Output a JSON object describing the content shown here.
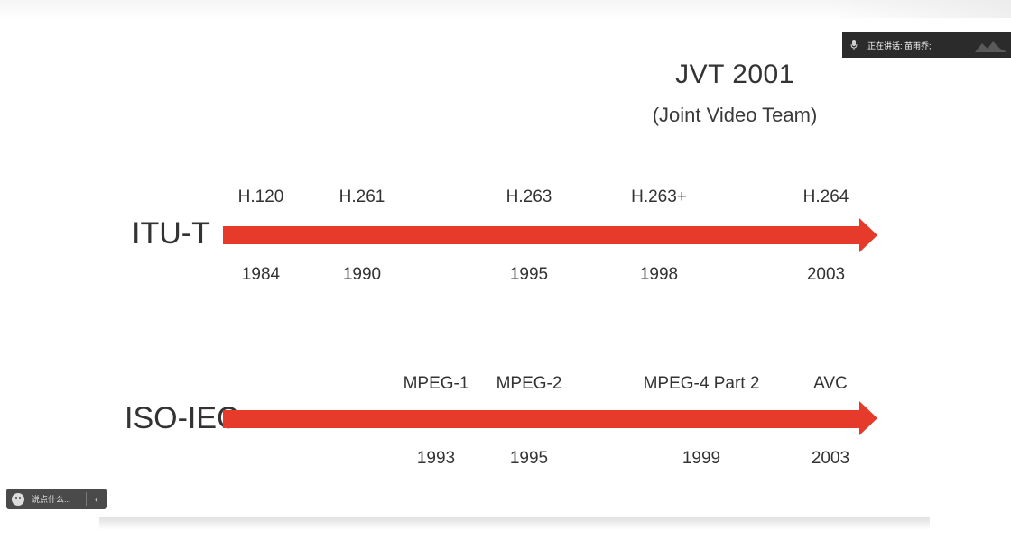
{
  "speaking_indicator": {
    "text": "正在讲话: 苗雨乔;"
  },
  "slide": {
    "jvt_title": "JVT 2001",
    "jvt_subtitle": "(Joint Video Team)",
    "itu": {
      "label": "ITU-T",
      "standards": [
        "H.120",
        "H.261",
        "H.263",
        "H.263+",
        "H.264"
      ],
      "years": [
        "1984",
        "1990",
        "1995",
        "1998",
        "2003"
      ]
    },
    "iso": {
      "label": "ISO-IEC",
      "standards": [
        "MPEG-1",
        "MPEG-2",
        "MPEG-4 Part 2",
        "AVC"
      ],
      "years": [
        "1993",
        "1995",
        "1999",
        "2003"
      ]
    },
    "arrow_color": "#e63a2a"
  },
  "chat": {
    "placeholder": "说点什么...",
    "toggle_icon": "chevron-left-icon",
    "emoji_icon": "emoji-icon"
  }
}
